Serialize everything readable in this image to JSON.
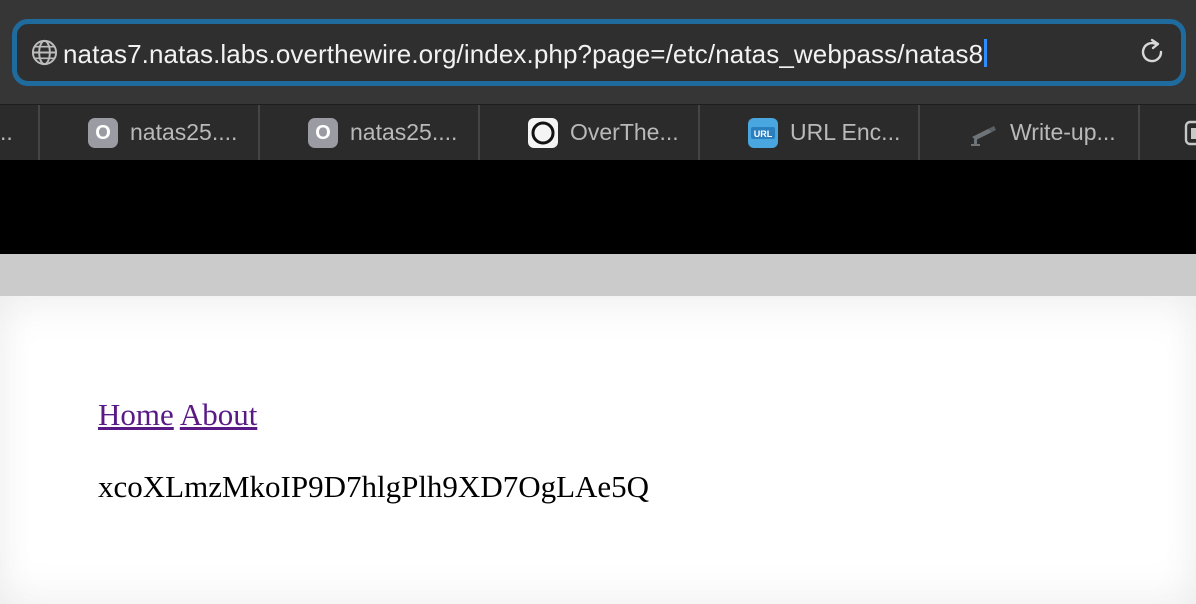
{
  "browser": {
    "address_bar": {
      "url": "natas7.natas.labs.overthewire.org/index.php?page=/etc/natas_webpass/natas8",
      "site_icon": "globe-icon",
      "reload_icon": "reload-icon"
    },
    "tabs": [
      {
        "label": "..",
        "icon": "none"
      },
      {
        "label": "natas25....",
        "icon": "o-badge-icon"
      },
      {
        "label": "natas25....",
        "icon": "o-badge-icon"
      },
      {
        "label": "OverThe...",
        "icon": "circle-logo-icon"
      },
      {
        "label": "URL Enc...",
        "icon": "url-badge-icon"
      },
      {
        "label": "Write-up...",
        "icon": "camera-icon"
      }
    ]
  },
  "page": {
    "nav": {
      "home_label": "Home",
      "about_label": "About"
    },
    "password": "xcoXLmzMkoIP9D7hlgPlh9XD7OgLAe5Q"
  },
  "colors": {
    "toolbar_bg": "#363636",
    "address_border": "#1f6b9e",
    "caret": "#2f8cff",
    "link": "#5a1a86",
    "header_band": "#000000",
    "grey_band": "#cbcbcb"
  }
}
